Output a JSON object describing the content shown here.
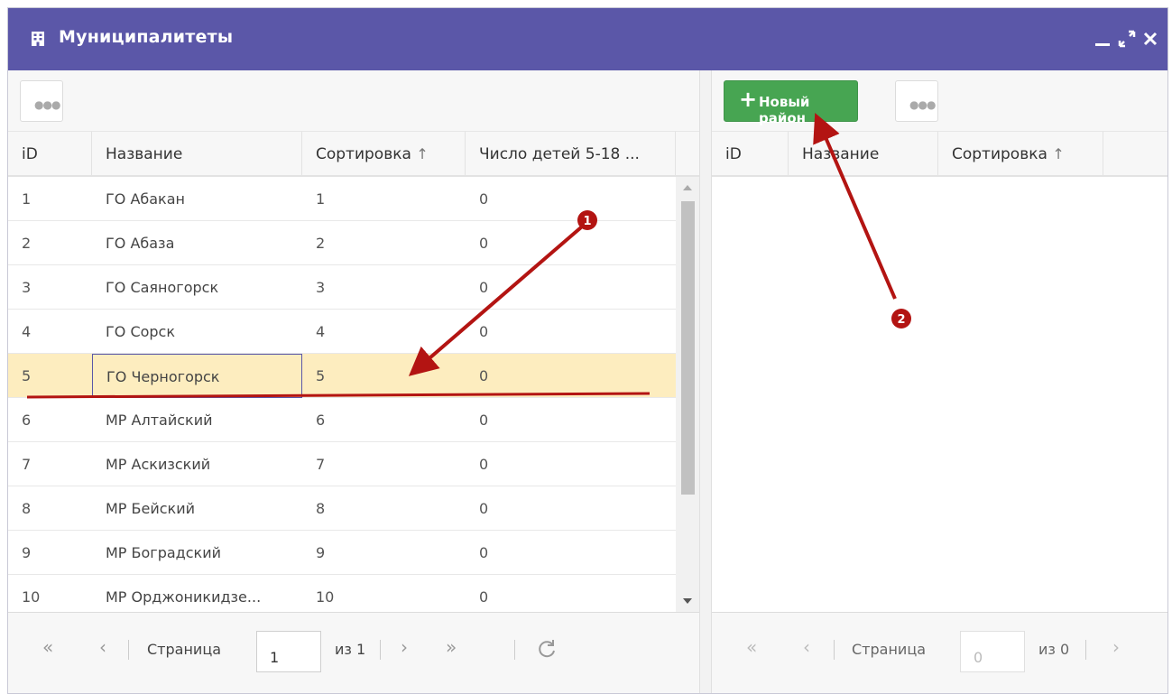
{
  "window": {
    "title": "Муниципалитеты",
    "title_icon": "building-icon",
    "controls": [
      "minimize-icon",
      "maximize-icon",
      "close-icon"
    ],
    "accent_color": "#5b57a8"
  },
  "left": {
    "columns": [
      "iD",
      "Название",
      "Сортировка",
      "Число детей 5-18 ..."
    ],
    "sort_indicator": "↑",
    "rows": [
      {
        "id": "1",
        "name": "ГО Абакан",
        "sort": "1",
        "children": "0"
      },
      {
        "id": "2",
        "name": "ГО Абаза",
        "sort": "2",
        "children": "0"
      },
      {
        "id": "3",
        "name": "ГО Саяногорск",
        "sort": "3",
        "children": "0"
      },
      {
        "id": "4",
        "name": "ГО Сорск",
        "sort": "4",
        "children": "0"
      },
      {
        "id": "5",
        "name": "ГО Черногорск",
        "sort": "5",
        "children": "0"
      },
      {
        "id": "6",
        "name": "МР Алтайский",
        "sort": "6",
        "children": "0"
      },
      {
        "id": "7",
        "name": "МР Аскизский",
        "sort": "7",
        "children": "0"
      },
      {
        "id": "8",
        "name": "МР Бейский",
        "sort": "8",
        "children": "0"
      },
      {
        "id": "9",
        "name": "МР Боградский",
        "sort": "9",
        "children": "0"
      },
      {
        "id": "10",
        "name": "МР Орджоникидзе...",
        "sort": "10",
        "children": "0"
      }
    ],
    "selected_row_id": "5",
    "pager": {
      "page_label": "Страница",
      "page_value": "1",
      "of_label": "из 1"
    }
  },
  "right": {
    "new_button_label": "Новый район",
    "new_button_color": "#47a552",
    "columns": [
      "iD",
      "Название",
      "Сортировка"
    ],
    "sort_indicator": "↑",
    "pager": {
      "page_label": "Страница",
      "page_value": "0",
      "of_label": "из 0"
    }
  },
  "annotations": {
    "marker_1": "1",
    "marker_2": "2",
    "color": "#b31412"
  }
}
